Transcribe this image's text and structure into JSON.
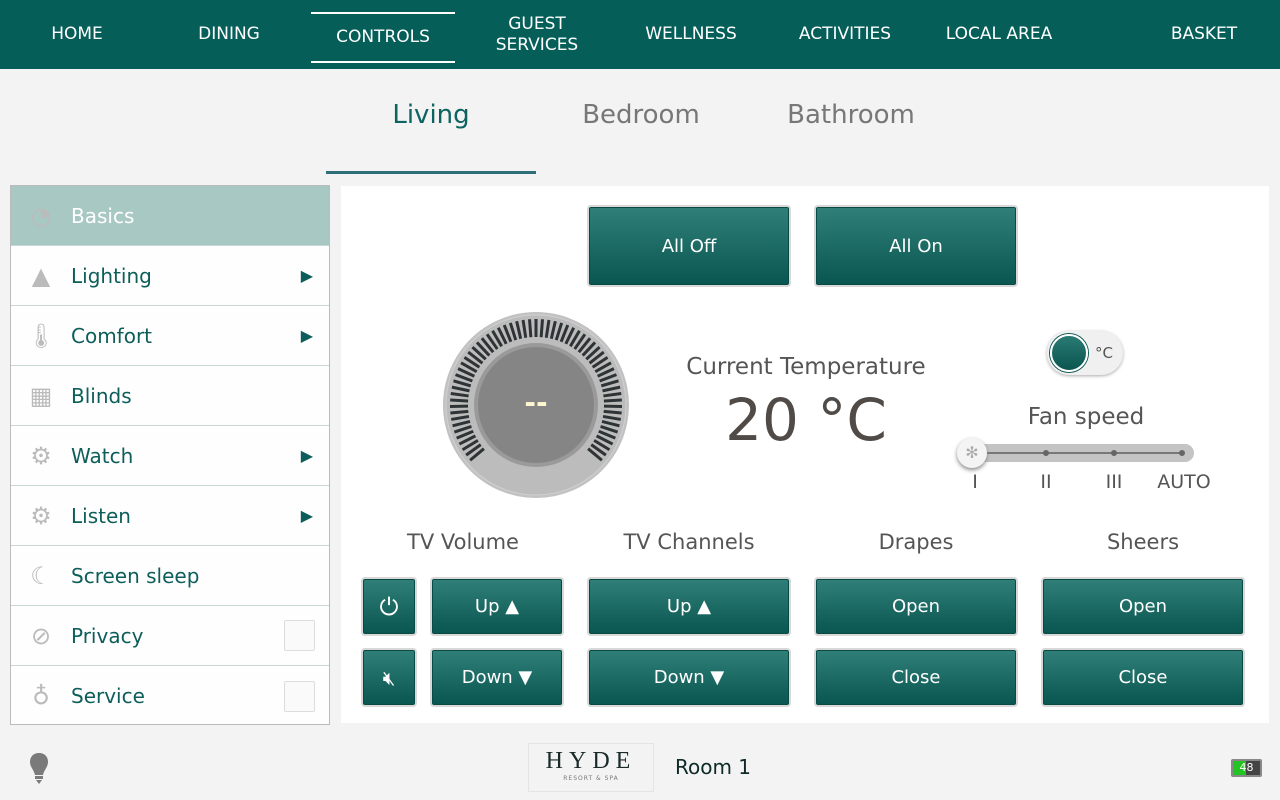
{
  "nav": {
    "items": [
      {
        "label": "HOME"
      },
      {
        "label": "DINING"
      },
      {
        "label": "CONTROLS",
        "active": true
      },
      {
        "label": "GUEST SERVICES"
      },
      {
        "label": "WELLNESS"
      },
      {
        "label": "ACTIVITIES"
      },
      {
        "label": "LOCAL AREA"
      },
      {
        "label": "BASKET"
      }
    ]
  },
  "tabs": [
    {
      "label": "Living",
      "active": true
    },
    {
      "label": "Bedroom"
    },
    {
      "label": "Bathroom"
    }
  ],
  "sidebar": {
    "items": [
      {
        "label": "Basics",
        "icon": "gauge-icon",
        "active": true
      },
      {
        "label": "Lighting",
        "icon": "lamp-icon",
        "arrow": true
      },
      {
        "label": "Comfort",
        "icon": "thermometer-icon",
        "arrow": true
      },
      {
        "label": "Blinds",
        "icon": "window-icon"
      },
      {
        "label": "Watch",
        "icon": "gear-icon",
        "arrow": true
      },
      {
        "label": "Listen",
        "icon": "gear-icon",
        "arrow": true
      },
      {
        "label": "Screen sleep",
        "icon": "moon-icon"
      },
      {
        "label": "Privacy",
        "icon": "no-entry-icon",
        "checkbox": false
      },
      {
        "label": "Service",
        "icon": "vacuum-icon",
        "checkbox": false
      }
    ]
  },
  "main": {
    "all_off": "All Off",
    "all_on": "All On",
    "dial_value": "--",
    "current_temp_label": "Current Temperature",
    "current_temp": "20 °C",
    "unit_toggle": "°C",
    "fan": {
      "label": "Fan speed",
      "ticks": [
        "I",
        "II",
        "III",
        "AUTO"
      ],
      "selected": "I"
    },
    "tv_volume": {
      "label": "TV Volume",
      "up": "Up ▲",
      "down": "Down ▼"
    },
    "tv_channels": {
      "label": "TV Channels",
      "up": "Up ▲",
      "down": "Down ▼"
    },
    "drapes": {
      "label": "Drapes",
      "open": "Open",
      "close": "Close"
    },
    "sheers": {
      "label": "Sheers",
      "open": "Open",
      "close": "Close"
    }
  },
  "footer": {
    "logo": "HYDE",
    "logo_sub": "RESORT & SPA",
    "room": "Room 1",
    "battery": "48"
  },
  "colors": {
    "nav": "#065e59",
    "accent": "#0d6360",
    "battery": "#22c322"
  }
}
